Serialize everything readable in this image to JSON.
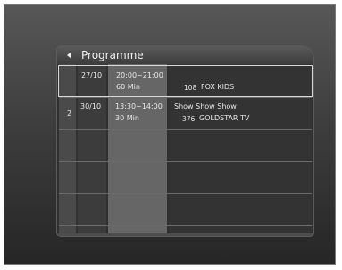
{
  "header": {
    "title": "Programme"
  },
  "rows": [
    {
      "index": "",
      "date": "27/10",
      "time": "20:00~21:00",
      "duration": "60 Min",
      "show": "",
      "channel_number": "108",
      "channel_name": "FOX KIDS",
      "selected": true
    },
    {
      "index": "2",
      "date": "30/10",
      "time": "13:30~14:00",
      "duration": "30 Min",
      "show": "Show Show Show",
      "channel_number": "376",
      "channel_name": "GOLDSTAR TV",
      "selected": false
    }
  ]
}
